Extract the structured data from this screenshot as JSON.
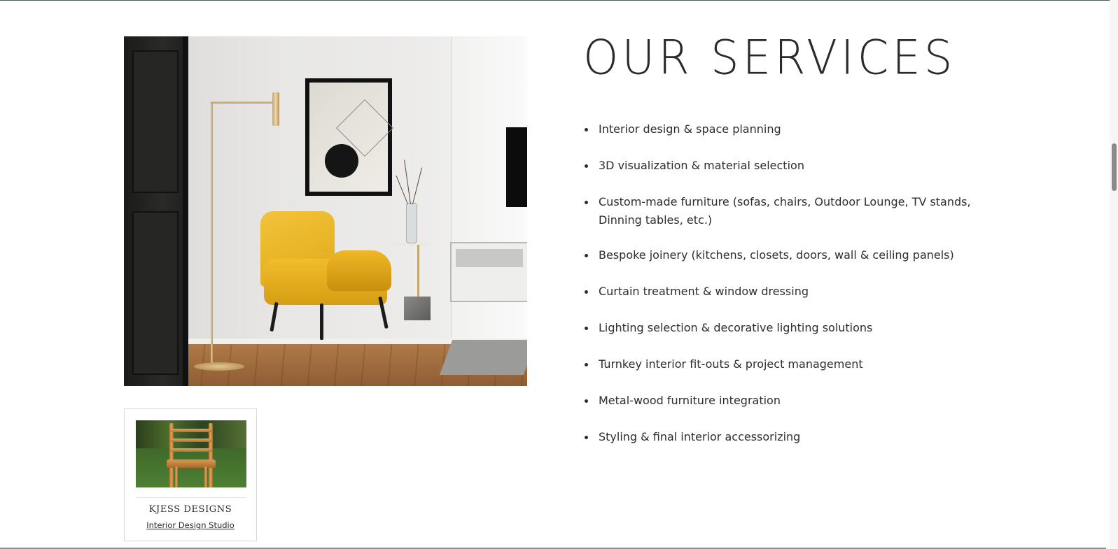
{
  "services": {
    "title": "OUR SERVICES",
    "items": [
      "Interior design & space planning",
      "3D visualization & material selection",
      "Custom-made furniture (sofas, chairs, Outdoor Lounge, TV stands, Dinning tables, etc.)",
      "Bespoke joinery (kitchens, closets, doors, wall & ceiling panels)",
      "Curtain treatment & window dressing",
      "Lighting selection & decorative lighting solutions",
      "Turnkey interior fit-outs & project management",
      "Metal-wood furniture integration",
      "Styling & final interior accessorizing"
    ]
  },
  "credit_card": {
    "brand": "KJESS DESIGNS",
    "subtitle": "Interior Design Studio"
  },
  "colors": {
    "text": "#2d2d2d",
    "chair_accent": "#f2bd2c",
    "background": "#ffffff"
  },
  "scrollbar": {
    "scroll_position_fraction": 0.27
  }
}
